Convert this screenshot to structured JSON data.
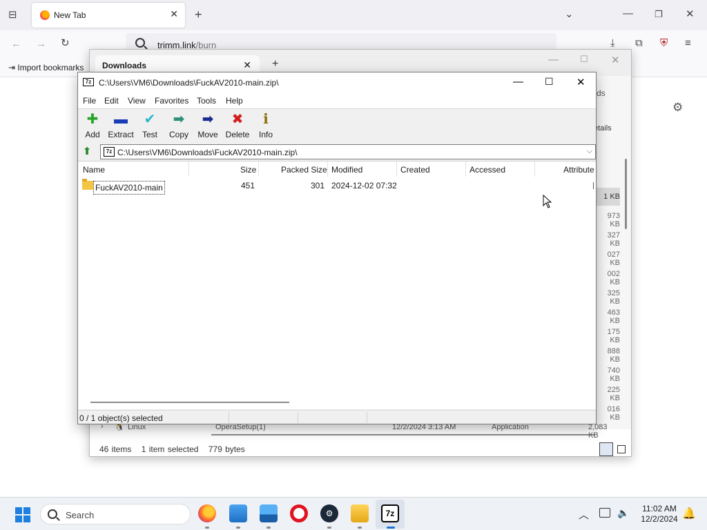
{
  "firefox": {
    "tab_title": "New Tab",
    "url_host": "trimm.link",
    "url_path": "/burn",
    "import_bookmarks": "Import bookmarks"
  },
  "downloads_window": {
    "tab_title": "Downloads",
    "partial_labels": [
      "ds",
      "etails"
    ],
    "sizes": [
      "1 KB",
      "973 KB",
      "327 KB",
      "027 KB",
      "002 KB",
      "325 KB",
      "463 KB",
      "175 KB",
      "888 KB",
      "740 KB",
      "225 KB",
      "016 KB",
      "2,083 KB"
    ],
    "bg_row": {
      "folder": "Linux",
      "file": "OperaSetup(1)",
      "date": "12/2/2024 3:13 AM",
      "type": "Application"
    },
    "status": {
      "items": "46 items",
      "selected": "1 item selected",
      "bytes": "779 bytes"
    }
  },
  "sevenzip": {
    "title": "C:\\Users\\VM6\\Downloads\\FuckAV2010-main.zip\\",
    "app_icon": "7z",
    "menu": [
      "File",
      "Edit",
      "View",
      "Favorites",
      "Tools",
      "Help"
    ],
    "toolbar": [
      {
        "label": "Add",
        "icon": "plus-icon",
        "glyph": "✚",
        "color": "#2aa52a"
      },
      {
        "label": "Extract",
        "icon": "minus-icon",
        "glyph": "▬",
        "color": "#1a3db5"
      },
      {
        "label": "Test",
        "icon": "check-icon",
        "glyph": "✔",
        "color": "#2bb7c9"
      },
      {
        "label": "Copy",
        "icon": "copy-arrow-icon",
        "glyph": "➡",
        "color": "#2f8f7a"
      },
      {
        "label": "Move",
        "icon": "move-arrow-icon",
        "glyph": "➡",
        "color": "#1a2a8f"
      },
      {
        "label": "Delete",
        "icon": "delete-x-icon",
        "glyph": "✖",
        "color": "#d21c1c"
      },
      {
        "label": "Info",
        "icon": "info-icon",
        "glyph": "ℹ",
        "color": "#8a6d0a"
      }
    ],
    "address": "C:\\Users\\VM6\\Downloads\\FuckAV2010-main.zip\\",
    "columns": [
      "Name",
      "Size",
      "Packed Size",
      "Modified",
      "Created",
      "Accessed",
      "Attribute"
    ],
    "rows": [
      {
        "name": "FuckAV2010-main",
        "size": "451",
        "packed": "301",
        "modified": "2024-12-02 07:32",
        "created": "",
        "accessed": "",
        "attr": ""
      }
    ],
    "status": "0 / 1 object(s) selected"
  },
  "taskbar": {
    "search_placeholder": "Search",
    "apps": [
      "firefox",
      "file-explorer",
      "photos",
      "opera",
      "steam",
      "folder",
      "7-zip"
    ],
    "time": "11:02 AM",
    "date": "12/2/2024"
  }
}
